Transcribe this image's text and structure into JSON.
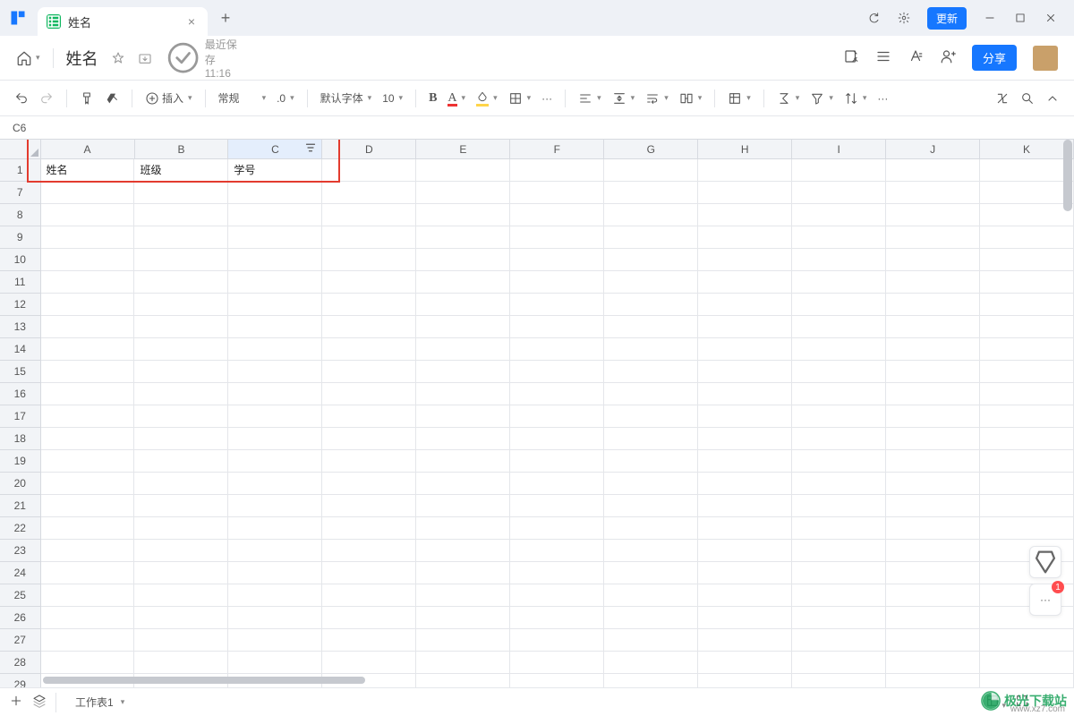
{
  "titlebar": {
    "tab_title": "姓名",
    "update_label": "更新"
  },
  "doc": {
    "title": "姓名",
    "save_status": "最近保存 11:16",
    "share_label": "分享"
  },
  "toolbar": {
    "insert_label": "插入",
    "number_format": "常规",
    "decimal_label": ".0",
    "font_name": "默认字体",
    "font_size": "10",
    "bold": "B"
  },
  "namebox": {
    "ref": "C6"
  },
  "columns": [
    "A",
    "B",
    "C",
    "D",
    "E",
    "F",
    "G",
    "H",
    "I",
    "J",
    "K"
  ],
  "row_start": 1,
  "row_skip_to": 7,
  "row_end": 29,
  "cells": {
    "r1": {
      "A": "姓名",
      "B": "班级",
      "C": "学号"
    }
  },
  "sheetbar": {
    "active_sheet": "工作表1"
  },
  "float": {
    "badge": "1"
  },
  "watermark": {
    "text": "极光下载站",
    "sub": "www.xz7.com"
  }
}
